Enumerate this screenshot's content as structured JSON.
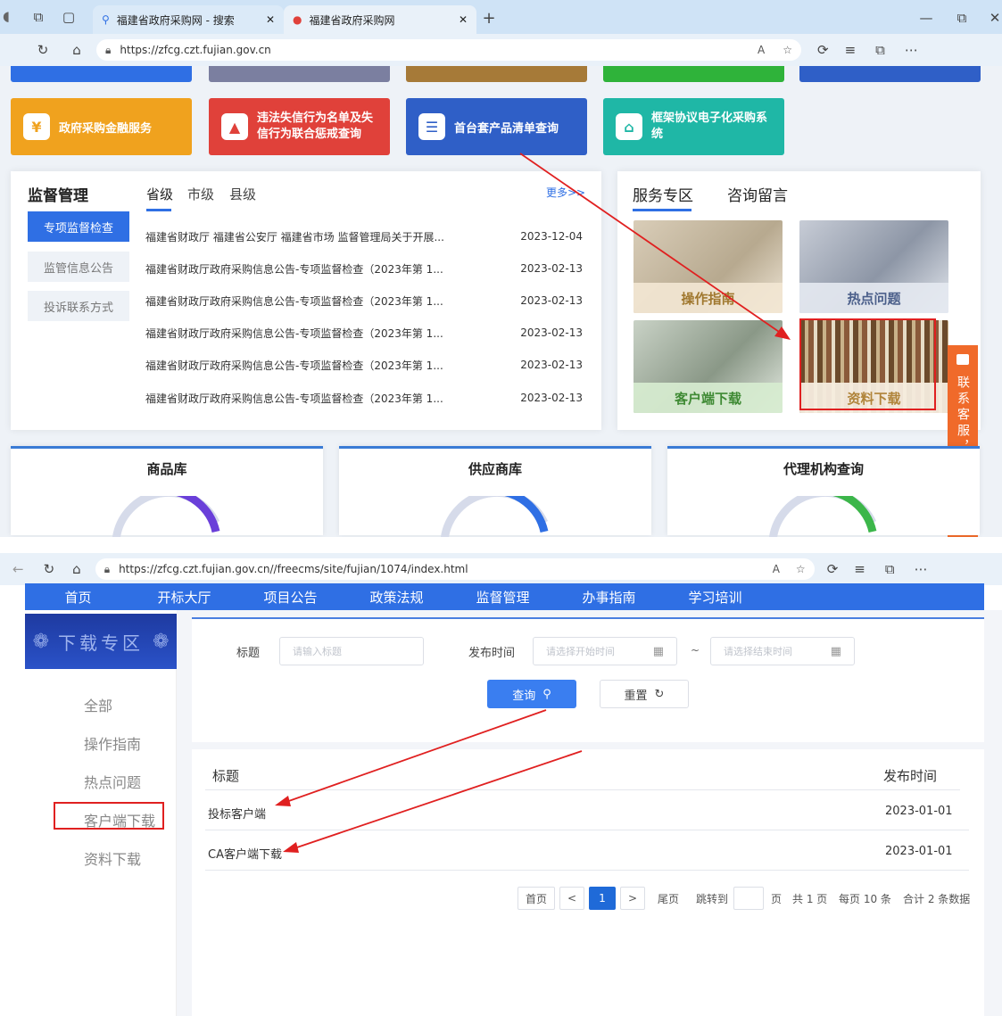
{
  "browser1": {
    "tabs": [
      {
        "label": "福建省政府采购网 - 搜索"
      },
      {
        "label": "福建省政府采购网"
      }
    ],
    "url": "https://zfcg.czt.fujian.gov.cn"
  },
  "tiles": [
    {
      "label": "政府采购金融服务",
      "color": "#f0a21e"
    },
    {
      "label": "违法失信行为名单及失信行为联合惩戒查询",
      "color": "#e0413a"
    },
    {
      "label": "首台套产品清单查询",
      "color": "#2f5fc7"
    },
    {
      "label": "框架协议电子化采购系统",
      "color": "#1fb7a6"
    }
  ],
  "supervision": {
    "title": "监督管理",
    "tabs": [
      "省级",
      "市级",
      "县级"
    ],
    "more": "更多>>",
    "side": [
      "专项监督检查",
      "监管信息公告",
      "投诉联系方式"
    ],
    "news": [
      {
        "title": "福建省财政厅 福建省公安厅 福建省市场 监督管理局关于开展...",
        "date": "2023-12-04"
      },
      {
        "title": "福建省财政厅政府采购信息公告-专项监督检查（2023年第 1...",
        "date": "2023-02-13"
      },
      {
        "title": "福建省财政厅政府采购信息公告-专项监督检查（2023年第 1...",
        "date": "2023-02-13"
      },
      {
        "title": "福建省财政厅政府采购信息公告-专项监督检查（2023年第 1...",
        "date": "2023-02-13"
      },
      {
        "title": "福建省财政厅政府采购信息公告-专项监督检查（2023年第 1...",
        "date": "2023-02-13"
      },
      {
        "title": "福建省财政厅政府采购信息公告-专项监督检查（2023年第 1...",
        "date": "2023-02-13"
      }
    ]
  },
  "service": {
    "tabs": [
      "服务专区",
      "咨询留言"
    ],
    "items": [
      "操作指南",
      "热点问题",
      "客户端下载",
      "资料下载"
    ]
  },
  "cards": [
    "商品库",
    "供应商库",
    "代理机构查询"
  ],
  "float_service": {
    "label": "联系客服，在线咨询"
  },
  "browser2": {
    "url": "https://zfcg.czt.fujian.gov.cn//freecms/site/fujian/1074/index.html"
  },
  "nav": [
    "首页",
    "开标大厅",
    "项目公告",
    "政策法规",
    "监督管理",
    "办事指南",
    "学习培训"
  ],
  "download": {
    "banner": "下载专区",
    "menu": [
      "全部",
      "操作指南",
      "热点问题",
      "客户端下载",
      "资料下载"
    ],
    "filter": {
      "title_label": "标题",
      "title_ph": "请输入标题",
      "time_label": "发布时间",
      "start_ph": "请选择开始时间",
      "sep": "~",
      "end_ph": "请选择结束时间",
      "query": "查询",
      "reset": "重置"
    },
    "table": {
      "headers": [
        "标题",
        "发布时间"
      ],
      "rows": [
        {
          "title": "投标客户端",
          "date": "2023-01-01"
        },
        {
          "title": "CA客户端下载",
          "date": "2023-01-01"
        }
      ]
    },
    "pager": {
      "first": "首页",
      "prev": "<",
      "current": "1",
      "next": ">",
      "last": "尾页",
      "jump": "跳转到",
      "page_unit": "页",
      "total_pages": "共 1 页",
      "per_page": "每页 10 条",
      "total": "合计 2 条数据"
    }
  },
  "colors": {
    "accent": "#2f6fe4",
    "highlight": "#e02020"
  }
}
